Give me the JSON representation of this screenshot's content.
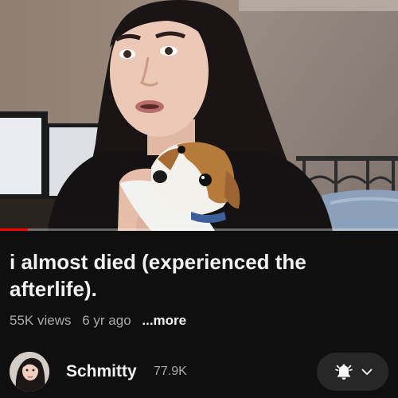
{
  "video": {
    "title": "i almost died (experienced the afterlife).",
    "views": "55K views",
    "age": "6 yr ago",
    "more_label": "...more",
    "progress_fraction": 0.07
  },
  "channel": {
    "name": "Schmitty",
    "subscribers": "77.9K",
    "avatar_icon": "channel-avatar"
  },
  "notification": {
    "bell_icon": "bell-notify-icon",
    "chevron_icon": "chevron-down-icon"
  },
  "colors": {
    "background": "#0f0f0f",
    "progress": "#ff0000",
    "pill": "#272727",
    "secondary_text": "#aaaaaa"
  }
}
